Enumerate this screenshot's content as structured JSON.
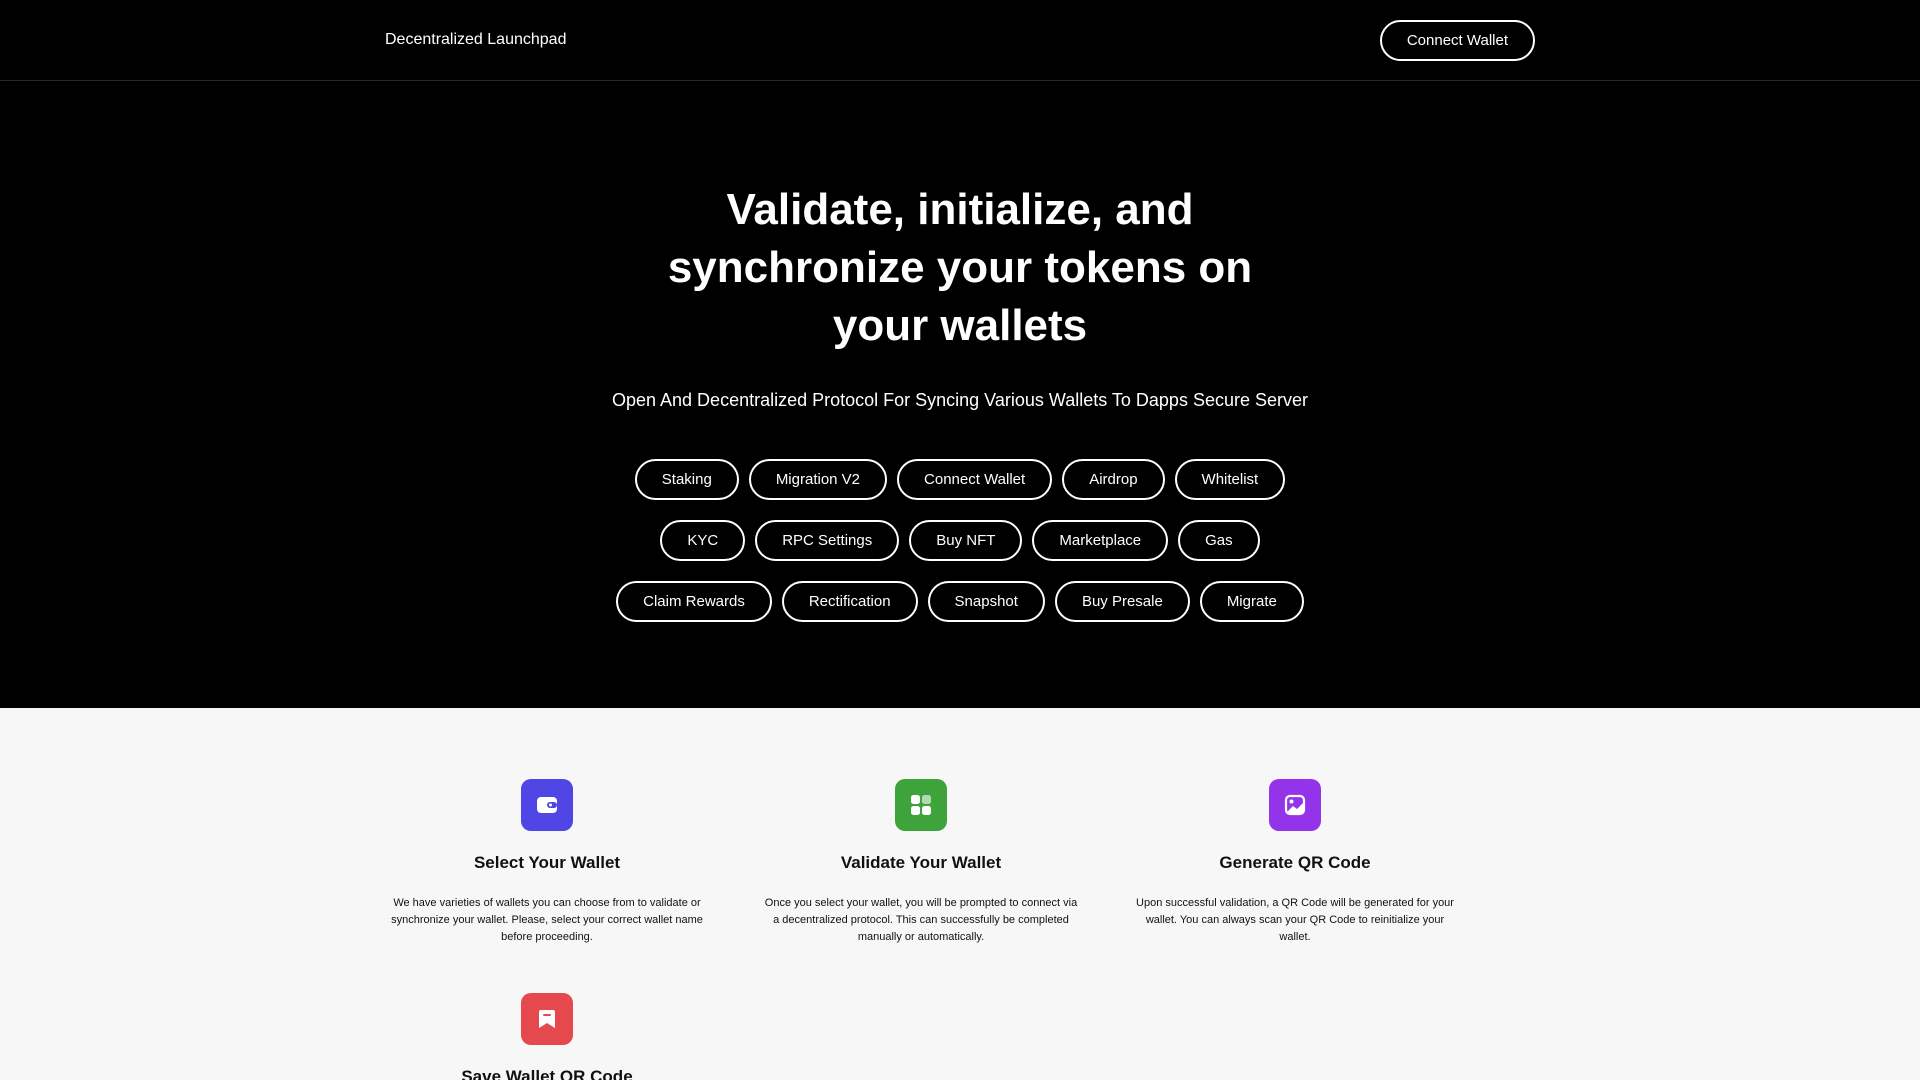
{
  "header": {
    "brand": "Decentralized Launchpad",
    "connect_label": "Connect Wallet"
  },
  "hero": {
    "title": "Validate, initialize, and synchronize your tokens on your wallets",
    "subtitle": "Open And Decentralized Protocol For Syncing Various Wallets To Dapps Secure Server",
    "pills": [
      "Staking",
      "Migration V2",
      "Connect Wallet",
      "Airdrop",
      "Whitelist",
      "KYC",
      "RPC Settings",
      "Buy NFT",
      "Marketplace",
      "Gas",
      "Claim Rewards",
      "Rectification",
      "Snapshot",
      "Buy Presale",
      "Migrate"
    ]
  },
  "features": [
    {
      "icon": "wallet-icon",
      "color": "#4f46e5",
      "title": "Select Your Wallet",
      "description": "We have varieties of wallets you can choose from to validate or synchronize your wallet. Please, select your correct wallet name before proceeding."
    },
    {
      "icon": "grid-icon",
      "color": "#3ea33a",
      "title": "Validate Your Wallet",
      "description": "Once you select your wallet, you will be prompted to connect via a decentralized protocol. This can successfully be completed manually or automatically."
    },
    {
      "icon": "qr-image-icon",
      "color": "#9333ea",
      "title": "Generate QR Code",
      "description": "Upon successful validation, a QR Code will be generated for your wallet. You can always scan your QR Code to reinitialize your wallet."
    },
    {
      "icon": "bookmark-icon",
      "color": "#e5484d",
      "title": "Save Wallet QR Code",
      "description": ""
    }
  ]
}
